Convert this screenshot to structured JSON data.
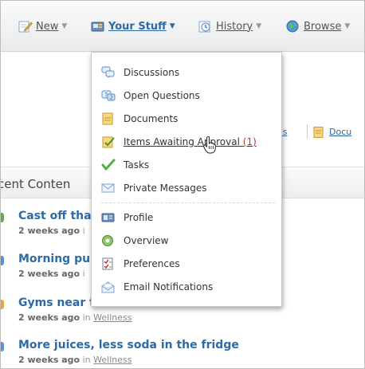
{
  "nav": {
    "new_label": "New",
    "your_stuff_label": "Your Stuff",
    "history_label": "History",
    "browse_label": "Browse"
  },
  "dropdown": {
    "discussions": "Discussions",
    "open_questions": "Open Questions",
    "documents": "Documents",
    "items_awaiting_approval": "Items Awaiting Approval",
    "items_awaiting_approval_count": "(1)",
    "tasks": "Tasks",
    "private_messages": "Private Messages",
    "profile": "Profile",
    "overview": "Overview",
    "preferences": "Preferences",
    "email_notifications": "Email Notifications"
  },
  "background": {
    "link_partial_1": "ons",
    "link_partial_2": "Docu",
    "section_title": "cent Conten",
    "items": [
      {
        "title": "Cast off tha",
        "meta_time": "2 weeks ago",
        "meta_in": "i",
        "category": ""
      },
      {
        "title": "Morning pu",
        "meta_time": "2 weeks ago",
        "meta_in": "i",
        "category": ""
      },
      {
        "title": "Gyms near t",
        "meta_time": "2 weeks ago",
        "meta_in": "in",
        "category": "Wellness"
      },
      {
        "title": "More juices, less soda in the fridge",
        "meta_time": "2 weeks ago",
        "meta_in": "in",
        "category": "Wellness"
      }
    ]
  },
  "colors": {
    "link_blue": "#2d6aa6",
    "count_red": "#c0392b",
    "dot_green": "#6aa84f",
    "dot_blue": "#5b8fd6",
    "dot_orange": "#f0a040"
  },
  "icons": {
    "new": "pencil-doc-icon",
    "your_stuff": "folder-stuff-icon",
    "history": "history-icon",
    "browse": "globe-icon"
  }
}
